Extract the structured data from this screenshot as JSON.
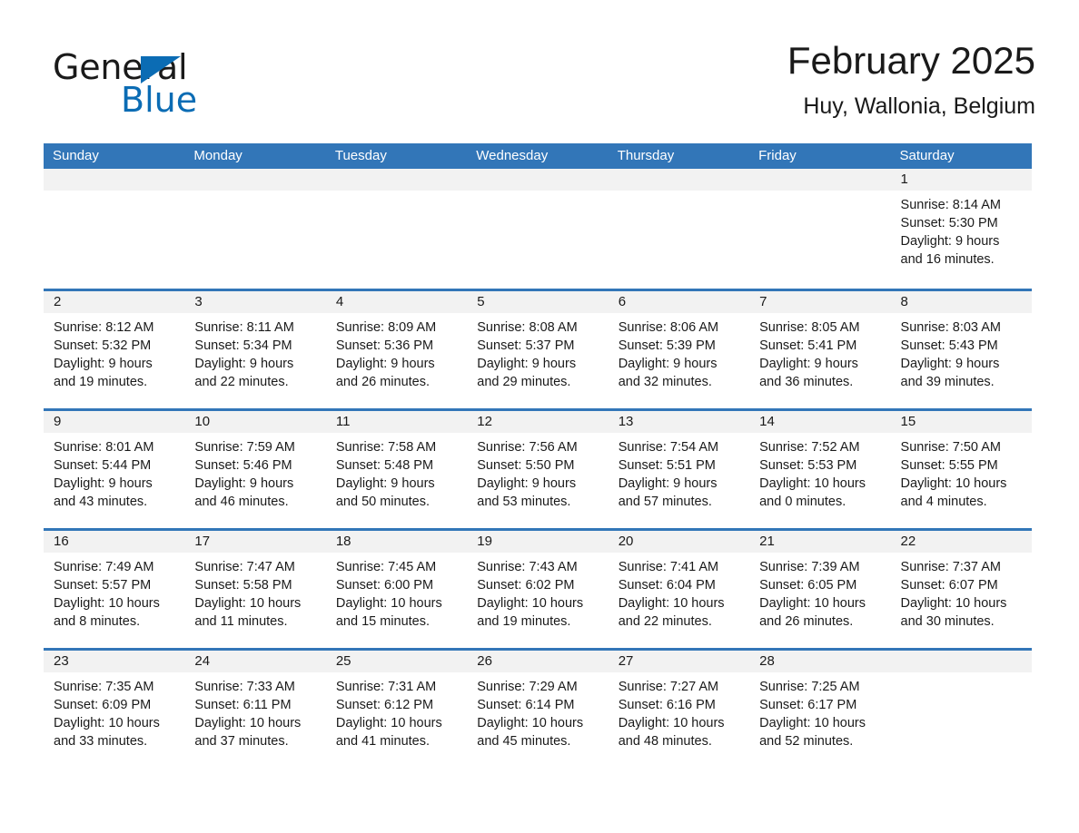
{
  "brand": {
    "name_part1": "General",
    "name_part2": "Blue",
    "accent_color": "#0b6cb4"
  },
  "header": {
    "title": "February 2025",
    "subtitle": "Huy, Wallonia, Belgium"
  },
  "theme": {
    "header_blue": "#3276b8",
    "day_band_gray": "#f2f2f2"
  },
  "weekdays": [
    "Sunday",
    "Monday",
    "Tuesday",
    "Wednesday",
    "Thursday",
    "Friday",
    "Saturday"
  ],
  "weeks": [
    [
      {
        "date": "",
        "sunrise": "",
        "sunset": "",
        "daylight": "",
        "empty": true
      },
      {
        "date": "",
        "sunrise": "",
        "sunset": "",
        "daylight": "",
        "empty": true
      },
      {
        "date": "",
        "sunrise": "",
        "sunset": "",
        "daylight": "",
        "empty": true
      },
      {
        "date": "",
        "sunrise": "",
        "sunset": "",
        "daylight": "",
        "empty": true
      },
      {
        "date": "",
        "sunrise": "",
        "sunset": "",
        "daylight": "",
        "empty": true
      },
      {
        "date": "",
        "sunrise": "",
        "sunset": "",
        "daylight": "",
        "empty": true
      },
      {
        "date": "1",
        "sunrise": "Sunrise: 8:14 AM",
        "sunset": "Sunset: 5:30 PM",
        "daylight": "Daylight: 9 hours and 16 minutes.",
        "empty": false
      }
    ],
    [
      {
        "date": "2",
        "sunrise": "Sunrise: 8:12 AM",
        "sunset": "Sunset: 5:32 PM",
        "daylight": "Daylight: 9 hours and 19 minutes.",
        "empty": false
      },
      {
        "date": "3",
        "sunrise": "Sunrise: 8:11 AM",
        "sunset": "Sunset: 5:34 PM",
        "daylight": "Daylight: 9 hours and 22 minutes.",
        "empty": false
      },
      {
        "date": "4",
        "sunrise": "Sunrise: 8:09 AM",
        "sunset": "Sunset: 5:36 PM",
        "daylight": "Daylight: 9 hours and 26 minutes.",
        "empty": false
      },
      {
        "date": "5",
        "sunrise": "Sunrise: 8:08 AM",
        "sunset": "Sunset: 5:37 PM",
        "daylight": "Daylight: 9 hours and 29 minutes.",
        "empty": false
      },
      {
        "date": "6",
        "sunrise": "Sunrise: 8:06 AM",
        "sunset": "Sunset: 5:39 PM",
        "daylight": "Daylight: 9 hours and 32 minutes.",
        "empty": false
      },
      {
        "date": "7",
        "sunrise": "Sunrise: 8:05 AM",
        "sunset": "Sunset: 5:41 PM",
        "daylight": "Daylight: 9 hours and 36 minutes.",
        "empty": false
      },
      {
        "date": "8",
        "sunrise": "Sunrise: 8:03 AM",
        "sunset": "Sunset: 5:43 PM",
        "daylight": "Daylight: 9 hours and 39 minutes.",
        "empty": false
      }
    ],
    [
      {
        "date": "9",
        "sunrise": "Sunrise: 8:01 AM",
        "sunset": "Sunset: 5:44 PM",
        "daylight": "Daylight: 9 hours and 43 minutes.",
        "empty": false
      },
      {
        "date": "10",
        "sunrise": "Sunrise: 7:59 AM",
        "sunset": "Sunset: 5:46 PM",
        "daylight": "Daylight: 9 hours and 46 minutes.",
        "empty": false
      },
      {
        "date": "11",
        "sunrise": "Sunrise: 7:58 AM",
        "sunset": "Sunset: 5:48 PM",
        "daylight": "Daylight: 9 hours and 50 minutes.",
        "empty": false
      },
      {
        "date": "12",
        "sunrise": "Sunrise: 7:56 AM",
        "sunset": "Sunset: 5:50 PM",
        "daylight": "Daylight: 9 hours and 53 minutes.",
        "empty": false
      },
      {
        "date": "13",
        "sunrise": "Sunrise: 7:54 AM",
        "sunset": "Sunset: 5:51 PM",
        "daylight": "Daylight: 9 hours and 57 minutes.",
        "empty": false
      },
      {
        "date": "14",
        "sunrise": "Sunrise: 7:52 AM",
        "sunset": "Sunset: 5:53 PM",
        "daylight": "Daylight: 10 hours and 0 minutes.",
        "empty": false
      },
      {
        "date": "15",
        "sunrise": "Sunrise: 7:50 AM",
        "sunset": "Sunset: 5:55 PM",
        "daylight": "Daylight: 10 hours and 4 minutes.",
        "empty": false
      }
    ],
    [
      {
        "date": "16",
        "sunrise": "Sunrise: 7:49 AM",
        "sunset": "Sunset: 5:57 PM",
        "daylight": "Daylight: 10 hours and 8 minutes.",
        "empty": false
      },
      {
        "date": "17",
        "sunrise": "Sunrise: 7:47 AM",
        "sunset": "Sunset: 5:58 PM",
        "daylight": "Daylight: 10 hours and 11 minutes.",
        "empty": false
      },
      {
        "date": "18",
        "sunrise": "Sunrise: 7:45 AM",
        "sunset": "Sunset: 6:00 PM",
        "daylight": "Daylight: 10 hours and 15 minutes.",
        "empty": false
      },
      {
        "date": "19",
        "sunrise": "Sunrise: 7:43 AM",
        "sunset": "Sunset: 6:02 PM",
        "daylight": "Daylight: 10 hours and 19 minutes.",
        "empty": false
      },
      {
        "date": "20",
        "sunrise": "Sunrise: 7:41 AM",
        "sunset": "Sunset: 6:04 PM",
        "daylight": "Daylight: 10 hours and 22 minutes.",
        "empty": false
      },
      {
        "date": "21",
        "sunrise": "Sunrise: 7:39 AM",
        "sunset": "Sunset: 6:05 PM",
        "daylight": "Daylight: 10 hours and 26 minutes.",
        "empty": false
      },
      {
        "date": "22",
        "sunrise": "Sunrise: 7:37 AM",
        "sunset": "Sunset: 6:07 PM",
        "daylight": "Daylight: 10 hours and 30 minutes.",
        "empty": false
      }
    ],
    [
      {
        "date": "23",
        "sunrise": "Sunrise: 7:35 AM",
        "sunset": "Sunset: 6:09 PM",
        "daylight": "Daylight: 10 hours and 33 minutes.",
        "empty": false
      },
      {
        "date": "24",
        "sunrise": "Sunrise: 7:33 AM",
        "sunset": "Sunset: 6:11 PM",
        "daylight": "Daylight: 10 hours and 37 minutes.",
        "empty": false
      },
      {
        "date": "25",
        "sunrise": "Sunrise: 7:31 AM",
        "sunset": "Sunset: 6:12 PM",
        "daylight": "Daylight: 10 hours and 41 minutes.",
        "empty": false
      },
      {
        "date": "26",
        "sunrise": "Sunrise: 7:29 AM",
        "sunset": "Sunset: 6:14 PM",
        "daylight": "Daylight: 10 hours and 45 minutes.",
        "empty": false
      },
      {
        "date": "27",
        "sunrise": "Sunrise: 7:27 AM",
        "sunset": "Sunset: 6:16 PM",
        "daylight": "Daylight: 10 hours and 48 minutes.",
        "empty": false
      },
      {
        "date": "28",
        "sunrise": "Sunrise: 7:25 AM",
        "sunset": "Sunset: 6:17 PM",
        "daylight": "Daylight: 10 hours and 52 minutes.",
        "empty": false
      },
      {
        "date": "",
        "sunrise": "",
        "sunset": "",
        "daylight": "",
        "empty": true
      }
    ]
  ]
}
